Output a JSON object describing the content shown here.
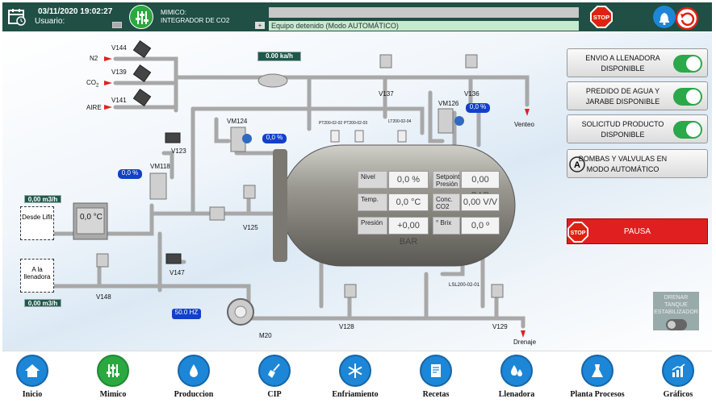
{
  "header": {
    "datetime": "03/11/2020 19:02:27",
    "user_label": "Usuario:",
    "screen_line1": "MIMICO:",
    "screen_line2": "INTEGRADOR DE CO2",
    "status_text": "Equipo detenido (Modo AUTOMÁTICO)",
    "plus": "+",
    "stop_label": "STOP",
    "reset_label": "Reset"
  },
  "valves": {
    "v144": "V144",
    "v139": "V139",
    "v141": "V141",
    "v123": "V123",
    "vm124": "VM124",
    "vm118": "VM118",
    "v125": "V125",
    "v147": "V147",
    "v148": "V148",
    "v137": "V137",
    "v136": "V136",
    "vm126": "VM126",
    "v128": "V128",
    "v129": "V129",
    "m20": "M20"
  },
  "gases": {
    "n2": "N2",
    "co2": "CO",
    "co2_sub": "2",
    "aire": "AIRE"
  },
  "flows": {
    "co2_flow": "0.00 ka/h",
    "in_flow": "0,00 m3/h",
    "out_flow": "0,00 m3/h",
    "temp_hx": "0,0 °C"
  },
  "pcts": {
    "vm124": "0,0 %",
    "vm118": "0,0 %",
    "vm126": "0,0 %"
  },
  "hz": "50.0 HZ",
  "boxes": {
    "desde": "Desde Lifit",
    "llenadora": "A la llenadora"
  },
  "labels": {
    "venteo": "Venteo",
    "drenaje": "Drenaje",
    "pt1": "PT200-02-02",
    "pt2": "PT200-02-03",
    "lt": "LT200-02-04",
    "lsl": "LSL200-02-01"
  },
  "tank": {
    "nivel_l": "Nivel",
    "nivel_v": "0,0 %",
    "sp_l": "Setpoint Presión",
    "sp_v": "0,00 BAR",
    "temp_l": "Temp.",
    "temp_v": "0,0 °C",
    "conc_l": "Conc. CO2",
    "conc_v": "0,00 V/V",
    "pres_l": "Presión",
    "pres_v": "+0,00 BAR",
    "brix_l": "° Brix",
    "brix_v": "0,0 º"
  },
  "right": {
    "b1": "ENVIO A LLENADORA DISPONIBLE",
    "b2": "PREDIDO DE AGUA Y JARABE DISPONIBLE",
    "b3": "SOLICITUD PRODUCTO DISPONIBLE",
    "b4": "BOMBAS Y VALVULAS EN MODO AUTOMÁTICO",
    "b4_badge": "A",
    "pausa": "PAUSA",
    "pausa_stop": "STOP",
    "drenar": "DRENAR TANQUE ESTABILIZADOR"
  },
  "nav": [
    {
      "label": "Inicio",
      "icon": "home-icon"
    },
    {
      "label": "Mimico",
      "icon": "sliders-icon"
    },
    {
      "label": "Produccion",
      "icon": "drop-icon"
    },
    {
      "label": "CIP",
      "icon": "broom-icon"
    },
    {
      "label": "Enfriamiento",
      "icon": "snowflake-icon"
    },
    {
      "label": "Recetas",
      "icon": "recipe-icon"
    },
    {
      "label": "Llenadora",
      "icon": "drops-icon"
    },
    {
      "label": "Planta Procesos",
      "icon": "flask-icon"
    },
    {
      "label": "Gráficos",
      "icon": "chart-icon"
    }
  ]
}
